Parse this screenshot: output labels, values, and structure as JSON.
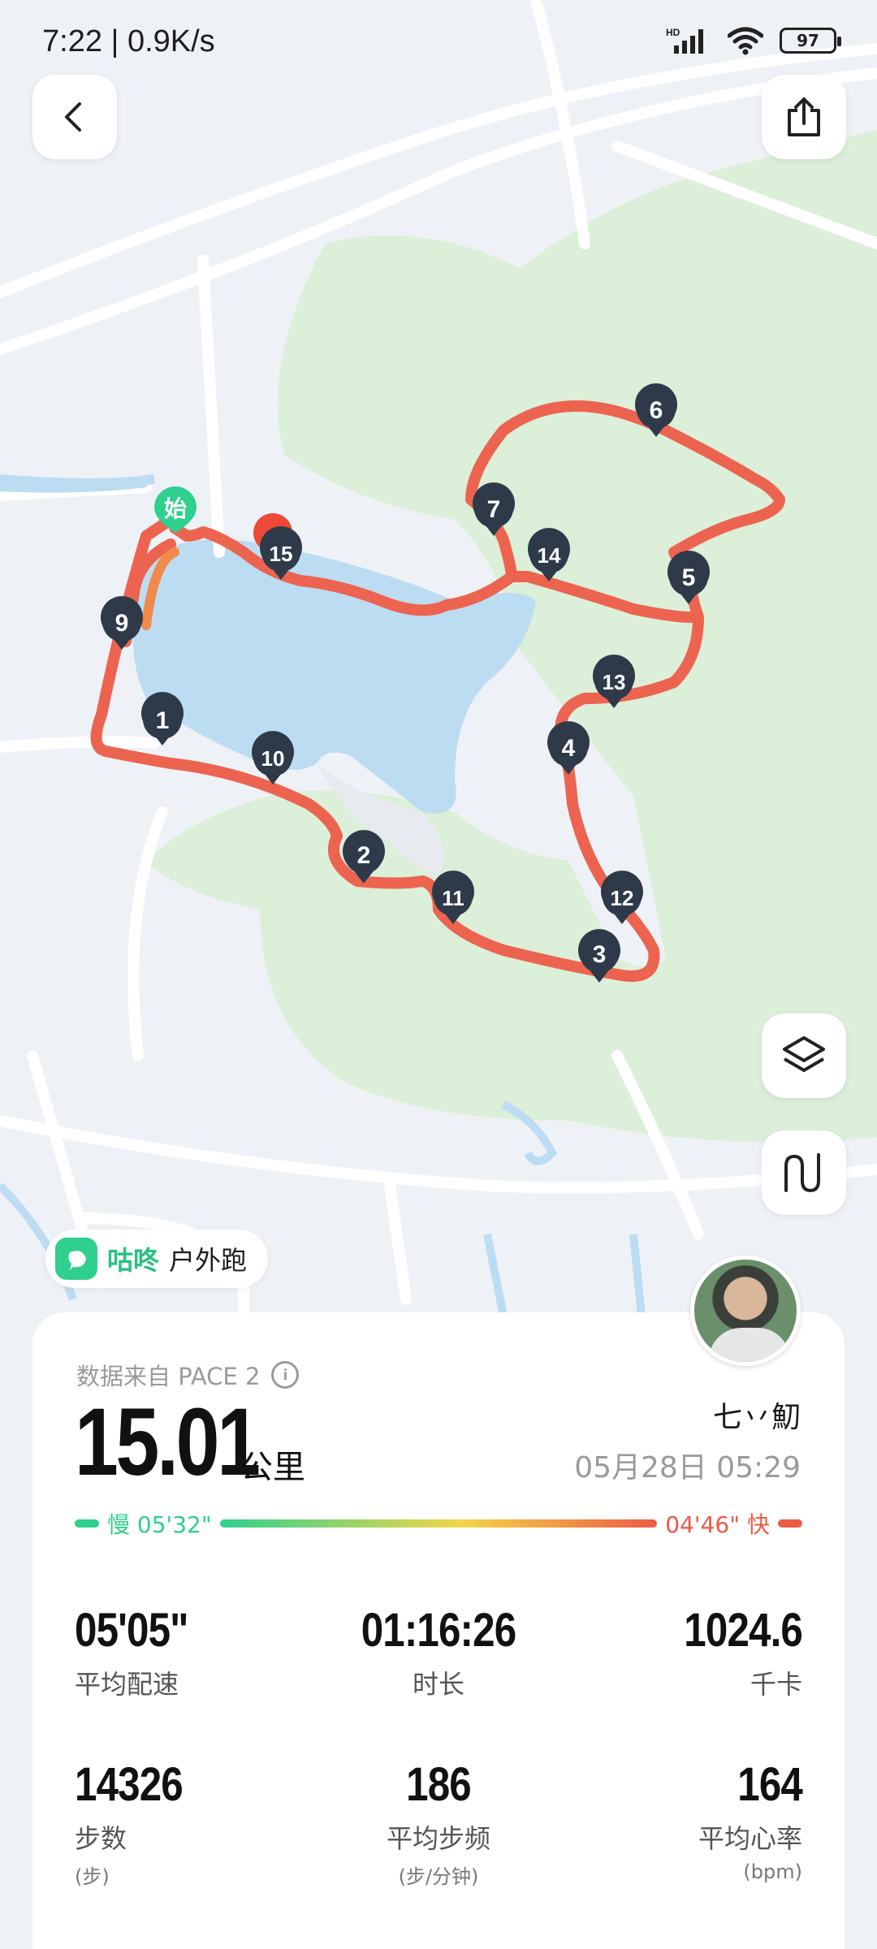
{
  "status_bar": {
    "time": "7:22 | 0.9K/s",
    "signal": "HD",
    "battery": "97"
  },
  "map": {
    "start_label": "始",
    "markers": [
      "1",
      "2",
      "3",
      "4",
      "5",
      "6",
      "7",
      "9",
      "10",
      "11",
      "12",
      "13",
      "14",
      "15"
    ],
    "route_color": "#ec6450"
  },
  "brand": {
    "name": "咕咚",
    "activity": "户外跑"
  },
  "card": {
    "source": "数据来自 PACE 2",
    "distance": "15.01",
    "distance_unit": "公里",
    "username": "七丷魛",
    "datetime": "05月28日 05:29",
    "pace_slow": "慢 05'32\"",
    "pace_fast": "04'46\" 快",
    "stats": [
      {
        "value": "05'05\"",
        "label": "平均配速",
        "sub": ""
      },
      {
        "value": "01:16:26",
        "label": "时长",
        "sub": ""
      },
      {
        "value": "1024.6",
        "label": "千卡",
        "sub": ""
      },
      {
        "value": "14326",
        "label": "步数",
        "sub": "(步)"
      },
      {
        "value": "186",
        "label": "平均步频",
        "sub": "(步/分钟)"
      },
      {
        "value": "164",
        "label": "平均心率",
        "sub": "(bpm)"
      }
    ]
  },
  "colors": {
    "accent_green": "#2fcf8e",
    "route": "#ec6450",
    "marker": "#2e3a4a"
  }
}
